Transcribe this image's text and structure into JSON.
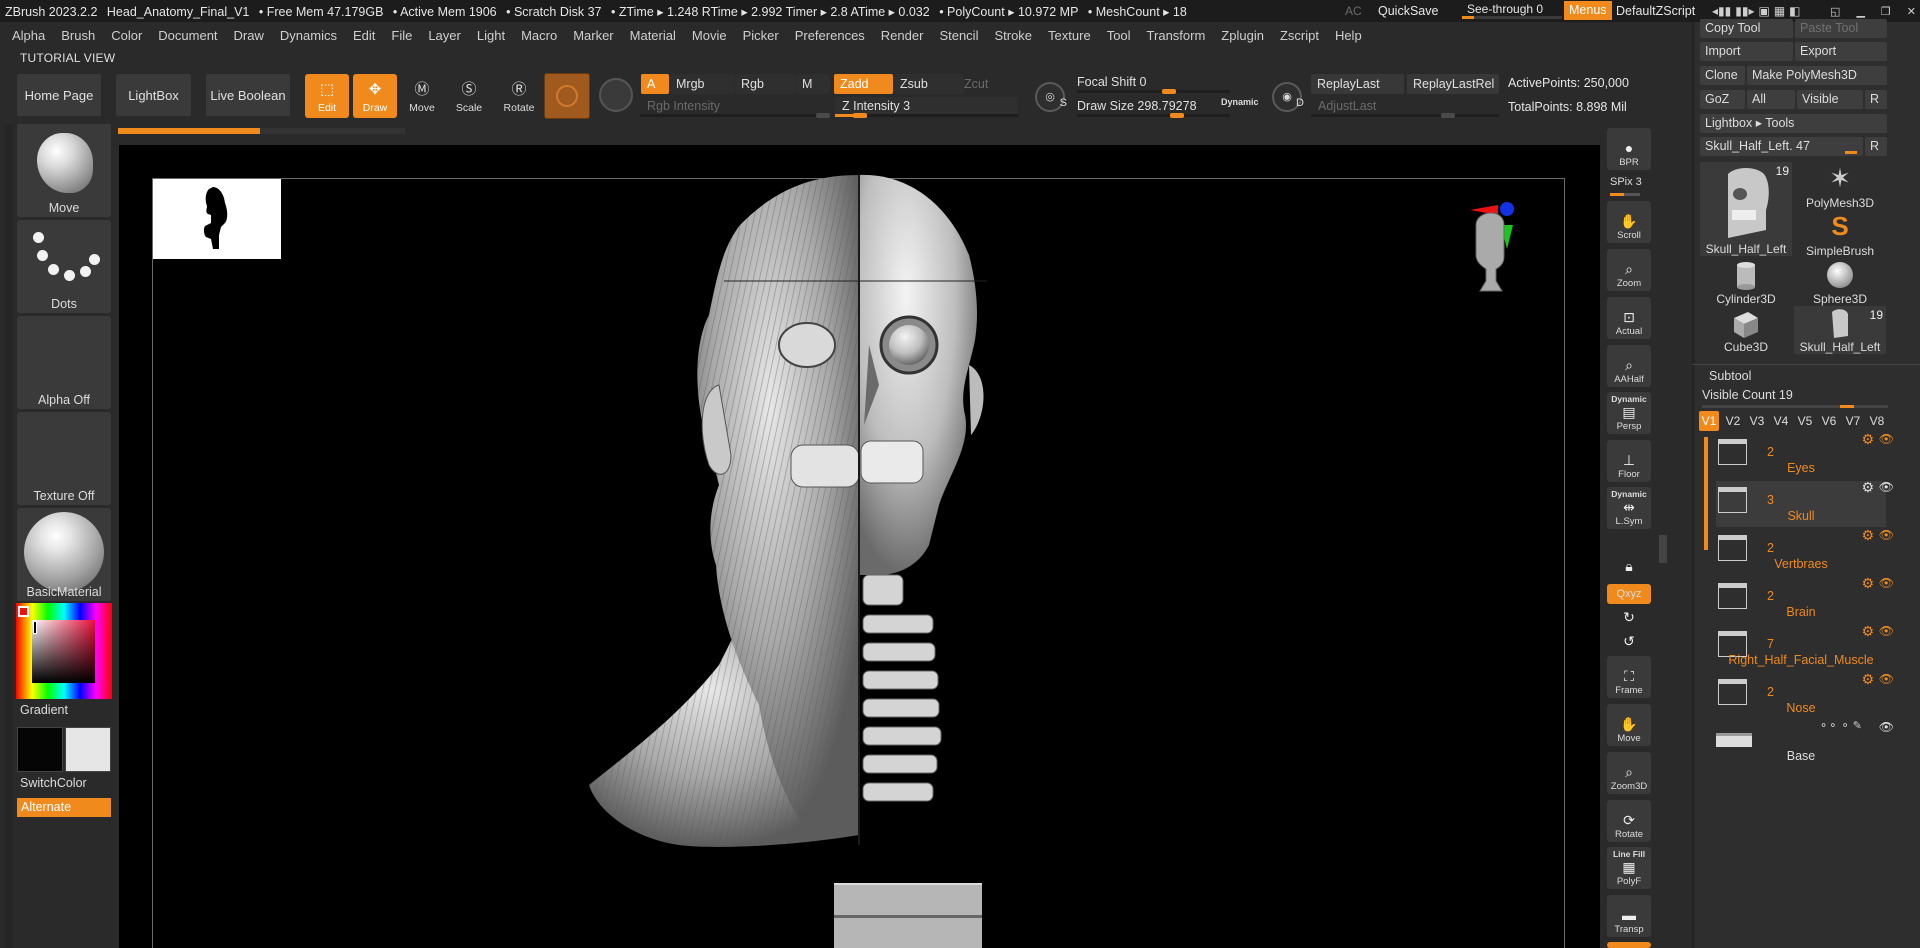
{
  "titlebar": {
    "app": "ZBrush 2023.2.2",
    "file": "Head_Anatomy_Final_V1",
    "free_mem": "• Free Mem 47.179GB",
    "active_mem": "• Active Mem 1906",
    "scratch": "• Scratch Disk 37",
    "ztime": "• ZTime ▸ 1.248 RTime ▸ 2.992 Timer ▸ 2.8 ATime ▸ 0.032",
    "polycount": "• PolyCount ▸ 10.972 MP",
    "meshcount": "• MeshCount ▸ 18",
    "ac": "AC",
    "quicksave": "QuickSave",
    "see_through": "See-through  0",
    "see_through_value": 0,
    "menus": "Menus",
    "default_zscript": "DefaultZScript"
  },
  "menubar": [
    "Alpha",
    "Brush",
    "Color",
    "Document",
    "Draw",
    "Dynamics",
    "Edit",
    "File",
    "Layer",
    "Light",
    "Macro",
    "Marker",
    "Material",
    "Movie",
    "Picker",
    "Preferences",
    "Render",
    "Stencil",
    "Stroke",
    "Texture",
    "Tool",
    "Transform",
    "Zplugin",
    "Zscript",
    "Help"
  ],
  "tutorial_view": "TUTORIAL VIEW",
  "shelf": {
    "home_page": "Home Page",
    "lightbox": "LightBox",
    "live_boolean": "Live Boolean",
    "edit": "Edit",
    "draw": "Draw",
    "move": "Move",
    "scale": "Scale",
    "rotate": "Rotate",
    "a": "A",
    "mrgb": "Mrgb",
    "rgb": "Rgb",
    "m": "M",
    "zadd": "Zadd",
    "zsub": "Zsub",
    "zcut": "Zcut",
    "rgb_intensity": "Rgb Intensity",
    "z_intensity": "Z Intensity 3",
    "z_intensity_value": 3,
    "focal_shift": "Focal Shift 0",
    "focal_shift_value": 0,
    "draw_size": "Draw Size  298.79278",
    "draw_size_value": 298.79278,
    "dynamic": "Dynamic",
    "s": "S",
    "d": "D",
    "replay_last": "ReplayLast",
    "replay_last_rel": "ReplayLastRel",
    "adjust_last": "AdjustLast",
    "active_points": "ActivePoints: 250,000",
    "total_points": "TotalPoints: 8.898 Mil"
  },
  "left": {
    "move": "Move",
    "dots": "Dots",
    "alpha_off": "Alpha Off",
    "texture_off": "Texture Off",
    "basic_material": "BasicMaterial",
    "gradient": "Gradient",
    "switch_color": "SwitchColor",
    "alternate": "Alternate"
  },
  "right_toolbar": {
    "bpr": "BPR",
    "spix": "SPix 3",
    "scroll": "Scroll",
    "zoom": "Zoom",
    "actual": "Actual",
    "aahalf": "AAHalf",
    "dynamic": "Dynamic",
    "persp": "Persp",
    "floor": "Floor",
    "lsym_dynamic": "Dynamic",
    "lsym": "L.Sym",
    "xyz": "Qxyz",
    "frame": "Frame",
    "move": "Move",
    "zoom3d": "Zoom3D",
    "rotate": "Rotate",
    "line_fill": "Line Fill",
    "polyf": "PolyF",
    "transp": "Transp"
  },
  "right_panel": {
    "copy_tool": "Copy Tool",
    "paste_tool": "Paste Tool",
    "import": "Import",
    "export": "Export",
    "clone": "Clone",
    "make_polymesh": "Make PolyMesh3D",
    "goz": "GoZ",
    "all": "All",
    "visible": "Visible",
    "r": "R",
    "lightbox_tools": "Lightbox ▸ Tools",
    "current_tool": "Skull_Half_Left. 47",
    "tools": [
      {
        "name": "Skull_Half_Left",
        "count": "19"
      },
      {
        "name": "PolyMesh3D",
        "count": ""
      },
      {
        "name": "SimpleBrush",
        "count": ""
      },
      {
        "name": "Cylinder3D",
        "count": ""
      },
      {
        "name": "Sphere3D",
        "count": ""
      },
      {
        "name": "Cube3D",
        "count": ""
      },
      {
        "name": "Skull_Half_Left",
        "count": "19"
      }
    ],
    "subtool": "Subtool",
    "visible_count": "Visible Count 19",
    "visible_count_value": 19,
    "vtabs": [
      "V1",
      "V2",
      "V3",
      "V4",
      "V5",
      "V6",
      "V7",
      "V8"
    ],
    "subtools": [
      {
        "count": "2",
        "name": "Eyes"
      },
      {
        "count": "3",
        "name": "Skull"
      },
      {
        "count": "2",
        "name": "Vertbraes"
      },
      {
        "count": "2",
        "name": "Brain"
      },
      {
        "count": "7",
        "name": "Right_Half_Facial_Muscle"
      },
      {
        "count": "2",
        "name": "Nose"
      },
      {
        "count": "",
        "name": "Base"
      }
    ]
  },
  "colors": {
    "accent": "#f08a1d",
    "background": "#2a2a2a",
    "canvas": "#000000",
    "titlebar": "#1c1c1c"
  }
}
